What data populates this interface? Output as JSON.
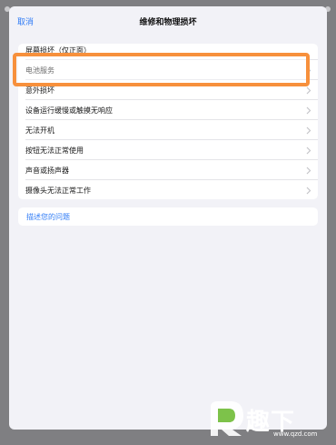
{
  "nav": {
    "cancel": "取消",
    "title": "维修和物理损坏"
  },
  "issues": [
    {
      "label": "屏幕损坏（仅正面）"
    },
    {
      "label": "电池服务"
    },
    {
      "label": "意外损坏"
    },
    {
      "label": "设备运行缓慢或触摸无响应"
    },
    {
      "label": "无法开机"
    },
    {
      "label": "按钮无法正常使用"
    },
    {
      "label": "声音或扬声器"
    },
    {
      "label": "摄像头无法正常工作"
    }
  ],
  "describe": {
    "label": "描述您的问题"
  },
  "watermark": {
    "brand": "趣下",
    "url": "www.qzd.com"
  },
  "colors": {
    "accent": "#2f7bf6",
    "highlight": "#f7903c"
  }
}
